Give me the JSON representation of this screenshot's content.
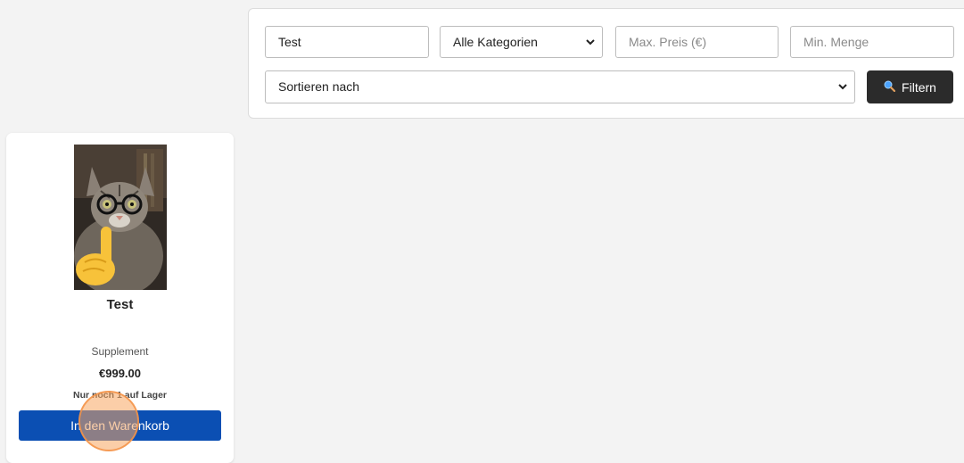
{
  "filters": {
    "search_value": "Test",
    "category_selected": "Alle Kategorien",
    "max_price_placeholder": "Max. Preis (€)",
    "min_quantity_placeholder": "Min. Menge",
    "sort_selected": "Sortieren nach",
    "filter_button_label": "Filtern",
    "filter_icon": "search-icon"
  },
  "product": {
    "name": "Test",
    "category": "Supplement",
    "price": "€999.00",
    "stock_note": "Nur noch 1 auf Lager",
    "add_to_cart_label": "In den Warenkorb",
    "image_description_icon": "cat-photo-image"
  },
  "colors": {
    "primary_button": "#0b4fb3",
    "filter_button": "#2b2b2b",
    "click_marker": "#f49346"
  }
}
